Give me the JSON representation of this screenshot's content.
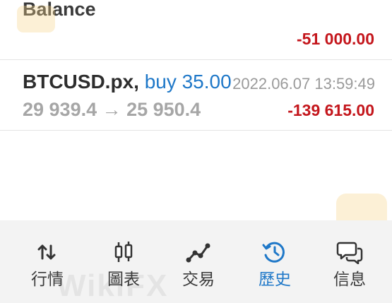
{
  "balance": {
    "label": "Balance",
    "amount": "-51 000.00"
  },
  "deal": {
    "symbol": "BTCUSD.px,",
    "type": "buy 35.00",
    "time": "2022.06.07 13:59:49",
    "prices": "29 939.4 → 25 950.4",
    "profit": "-139 615.00"
  },
  "tabs": [
    {
      "label": "行情",
      "icon": "quotes-arrows-icon"
    },
    {
      "label": "圖表",
      "icon": "candlestick-chart-icon"
    },
    {
      "label": "交易",
      "icon": "trade-line-icon"
    },
    {
      "label": "歷史",
      "icon": "history-clock-icon",
      "active": true
    },
    {
      "label": "信息",
      "icon": "messages-chat-icon"
    }
  ],
  "watermark": {
    "text": "WikiFX"
  },
  "colors": {
    "negative": "#c4161c",
    "accent": "#1f78c8",
    "muted": "#a6a6a6"
  }
}
